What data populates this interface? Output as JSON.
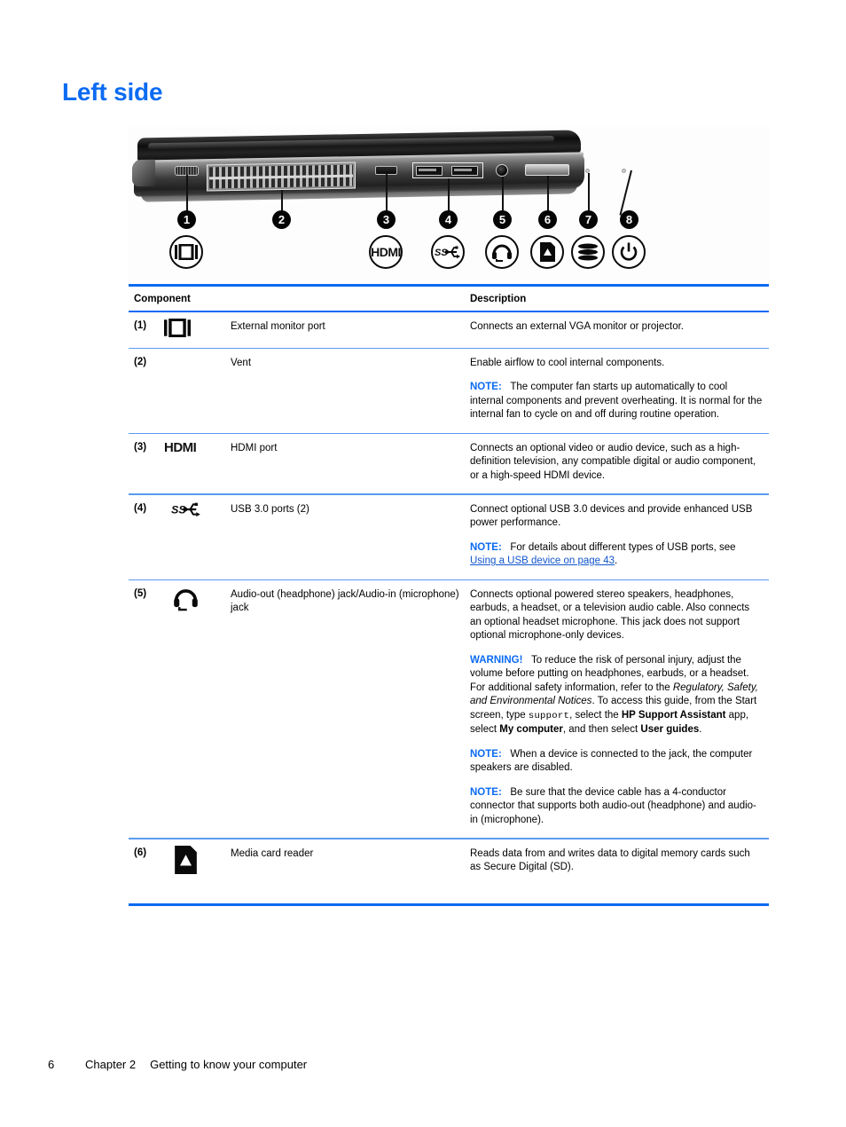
{
  "heading": "Left side",
  "figure": {
    "alt": "Left side view of laptop with numbered callouts",
    "callouts": [
      "1",
      "2",
      "3",
      "4",
      "5",
      "6",
      "7",
      "8"
    ],
    "icon_names": [
      "external-monitor-icon",
      "hdmi-icon",
      "usb-superspeed-icon",
      "headset-icon",
      "media-card-icon",
      "drive-icon",
      "power-icon"
    ],
    "hdmi_label": "HDMI",
    "ss_label": "SS"
  },
  "table": {
    "headers": {
      "component": "Component",
      "description": "Description"
    },
    "rows": [
      {
        "num": "(1)",
        "icon": "external-monitor-icon",
        "name": "External monitor port",
        "desc_1": "Connects an external VGA monitor or projector."
      },
      {
        "num": "(2)",
        "icon": "none",
        "name": "Vent",
        "desc_1": "Enable airflow to cool internal components.",
        "note_label": "NOTE:",
        "note_1": "The computer fan starts up automatically to cool internal components and prevent overheating. It is normal for the internal fan to cycle on and off during routine operation."
      },
      {
        "num": "(3)",
        "icon": "hdmi-icon",
        "name": "HDMI port",
        "desc_1": "Connects an optional video or audio device, such as a high-definition television, any compatible digital or audio component, or a high-speed HDMI device."
      },
      {
        "num": "(4)",
        "icon": "usb-superspeed-icon",
        "name": "USB 3.0 ports (2)",
        "desc_1": "Connect optional USB 3.0 devices and provide enhanced USB power performance.",
        "note_label": "NOTE:",
        "note_pre": "For details about different types of USB ports, see ",
        "note_link": "Using a USB device on page 43",
        "note_post": "."
      },
      {
        "num": "(5)",
        "icon": "headset-icon",
        "name": "Audio-out (headphone) jack/Audio-in (microphone) jack",
        "desc_1": "Connects optional powered stereo speakers, headphones, earbuds, a headset, or a television audio cable. Also connects an optional headset microphone. This jack does not support optional microphone-only devices.",
        "warn_label": "WARNING!",
        "warn_a": "To reduce the risk of personal injury, adjust the volume before putting on headphones, earbuds, or a headset. For additional safety information, refer to the ",
        "warn_italic": "Regulatory, Safety, and Environmental Notices",
        "warn_b": ". To access this guide, from the Start screen, type ",
        "warn_mono": "support",
        "warn_c": ", select the ",
        "warn_bold1": "HP Support Assistant",
        "warn_d": " app, select ",
        "warn_bold2": "My computer",
        "warn_e": ", and then select ",
        "warn_bold3": "User guides",
        "warn_f": ".",
        "note2_label": "NOTE:",
        "note2": "When a device is connected to the jack, the computer speakers are disabled.",
        "note3_label": "NOTE:",
        "note3": "Be sure that the device cable has a 4-conductor connector that supports both audio-out (headphone) and audio-in (microphone)."
      },
      {
        "num": "(6)",
        "icon": "media-card-icon",
        "name": "Media card reader",
        "desc_1": "Reads data from and writes data to digital memory cards such as Secure Digital (SD)."
      }
    ]
  },
  "footer": {
    "page_number": "6",
    "chapter": "Chapter 2",
    "chapter_title": "Getting to know your computer"
  },
  "colors": {
    "accent_blue": "#0b6bf2",
    "link_blue": "#1155cc"
  }
}
